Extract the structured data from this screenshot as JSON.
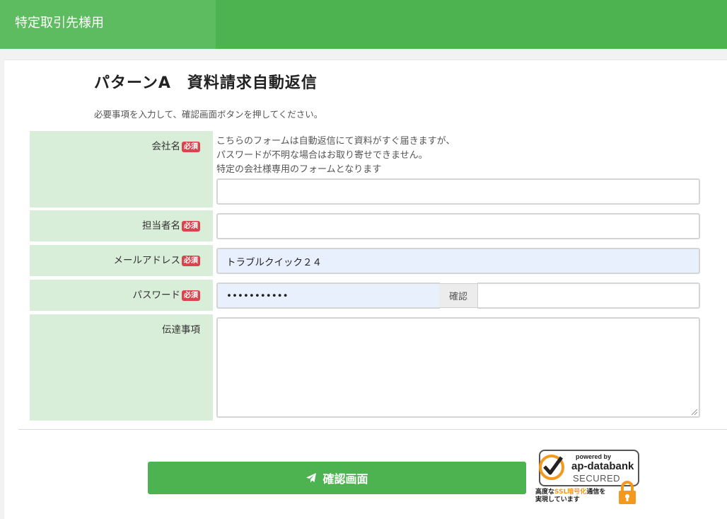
{
  "header": {
    "title": "特定取引先様用"
  },
  "page": {
    "title": "パターンA　資料請求自動返信",
    "lead": "必要事項を入力して、確認画面ボタンを押してください。"
  },
  "form": {
    "required_badge": "必須",
    "company": {
      "label": "会社名",
      "note": [
        "こちらのフォームは自動返信にて資料がすぐ届きますが、",
        "パスワードが不明な場合はお取り寄せできません。",
        "特定の会社様専用のフォームとなります"
      ],
      "value": ""
    },
    "contact": {
      "label": "担当者名",
      "value": ""
    },
    "email": {
      "label": "メールアドレス",
      "value": "トラブルクイック２４"
    },
    "password": {
      "label": "パスワード",
      "value": "•••••••••••",
      "confirm_label": "確認",
      "confirm_value": ""
    },
    "message": {
      "label": "伝達事項",
      "value": ""
    }
  },
  "submit": {
    "label": "確認画面",
    "icon": "paper-plane-icon"
  },
  "seal": {
    "powered_by": "powered by",
    "brand": "ap-databank",
    "secured": "SECURED",
    "line1_pre": "高度な",
    "line1_hl": "SSL暗号化",
    "line1_post": "通信を",
    "line2": "実現しています",
    "colors": {
      "accent": "#f39a1e"
    }
  },
  "colors": {
    "brand": "#4db250",
    "label_bg": "#d9eed9",
    "required": "#d9444f",
    "autofill": "#e8f0fe"
  }
}
